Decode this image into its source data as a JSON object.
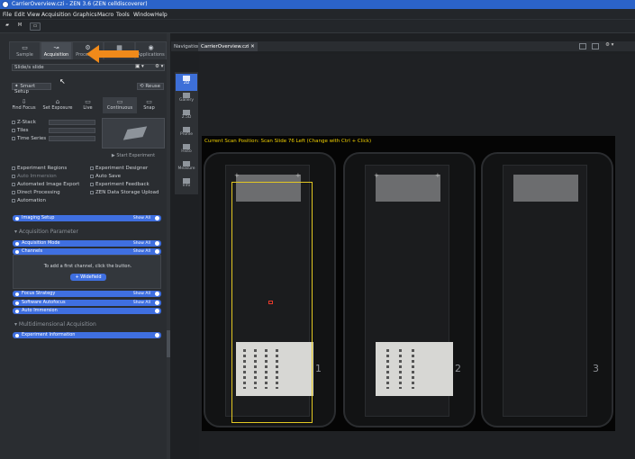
{
  "window": {
    "title": "CarrierOverview.czi - ZEN 3.6 (ZEN celldiscoverer)"
  },
  "menu": [
    "File",
    "Edit",
    "View",
    "Acquisition",
    "Graphics",
    "Macro",
    "Tools",
    "Window",
    "Help"
  ],
  "toolbar": {
    "m_label": "M"
  },
  "left_tabs": [
    {
      "label": "Sample",
      "icon": "sample-icon"
    },
    {
      "label": "Acquisition",
      "icon": "acquisition-icon",
      "active": true
    },
    {
      "label": "Processing",
      "icon": "processing-icon"
    },
    {
      "label": "",
      "icon": "analysis-icon"
    },
    {
      "label": "Applications",
      "icon": "applications-icon"
    }
  ],
  "sample_select": "Slide/s slide",
  "smart_setup": "Smart Setup",
  "reuse": "Reuse",
  "actions": [
    "Find Focus",
    "Set Exposure",
    "Live",
    "Continuous",
    "Snap"
  ],
  "dims": [
    "Z-Stack",
    "Tiles",
    "Time Series"
  ],
  "start_experiment": "Start Experiment",
  "options_left": [
    "Experiment Regions",
    "Auto Immersion",
    "Automated Image Export",
    "Direct Processing",
    "Automation"
  ],
  "options_right": [
    "Experiment Designer",
    "Auto Save",
    "Experiment Feedback",
    "ZEN Data Storage Upload"
  ],
  "imaging_setup": "Imaging Setup",
  "show_all": "Show All",
  "acq_param": "Acquisition Parameter",
  "acq_mode": "Acquisition Mode",
  "channels": "Channels",
  "channels_msg": "To add a first channel, click the button.",
  "widefield": "+ Widefield",
  "focus_strategy": "Focus Strategy",
  "software_autofocus": "Software Autofocus",
  "auto_immersion": "Auto Immersion",
  "multidim": "Multidimensional Acquisition",
  "experiment_info": "Experiment Information",
  "nav_tabs": [
    "Navigation",
    "CarrierOverview.czi"
  ],
  "view_buttons": [
    "2D",
    "Gallery",
    "2.5D",
    "Profile",
    "Histo",
    "Measure",
    "Info"
  ],
  "scan_position": "Current Scan Position: Scan Slide 76 Left (Change with Ctrl + Click)",
  "slide_numbers": [
    "1",
    "2",
    "3"
  ],
  "colors": {
    "accent": "#3f6fe0",
    "arrow": "#f08a1a",
    "highlight": "#e2c722",
    "title": "#2b63c9"
  }
}
